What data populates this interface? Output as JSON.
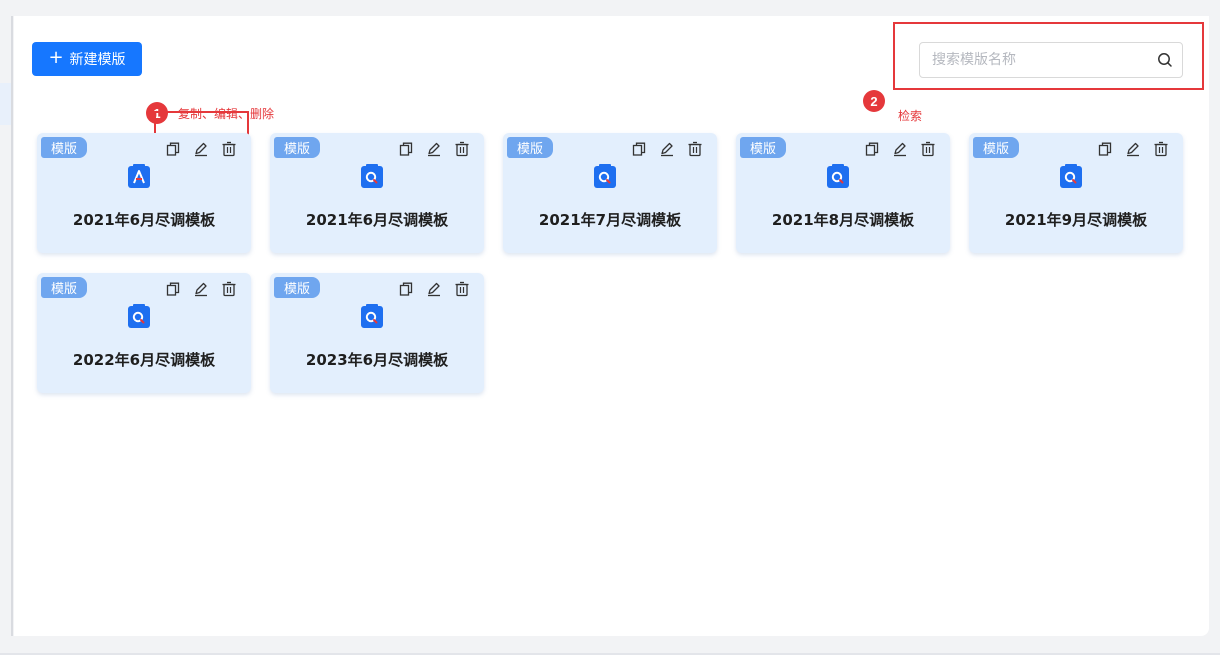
{
  "toolbar": {
    "new_template_label": "新建模版",
    "new_template_icon": "plus-icon"
  },
  "search": {
    "placeholder": "搜索模版名称",
    "icon": "search-icon"
  },
  "annotations": [
    {
      "number": "1",
      "text": "复制、编辑、删除"
    },
    {
      "number": "2",
      "text": "检索"
    }
  ],
  "templates": [
    {
      "tag": "模版",
      "title": "2021年6月尽调模板",
      "icon": "doc-a-icon"
    },
    {
      "tag": "模版",
      "title": "2021年6月尽调模板",
      "icon": "doc-search-icon"
    },
    {
      "tag": "模版",
      "title": "2021年7月尽调模板",
      "icon": "doc-search-icon"
    },
    {
      "tag": "模版",
      "title": "2021年8月尽调模板",
      "icon": "doc-search-icon"
    },
    {
      "tag": "模版",
      "title": "2021年9月尽调模板",
      "icon": "doc-search-icon"
    },
    {
      "tag": "模版",
      "title": "2022年6月尽调模板",
      "icon": "doc-search-icon"
    },
    {
      "tag": "模版",
      "title": "2023年6月尽调模板",
      "icon": "doc-search-icon"
    }
  ],
  "colors": {
    "primary": "#1677ff",
    "card_bg": "#e3effd",
    "tag_bg": "#6fa6ef",
    "annotation_red": "#e5383b"
  }
}
